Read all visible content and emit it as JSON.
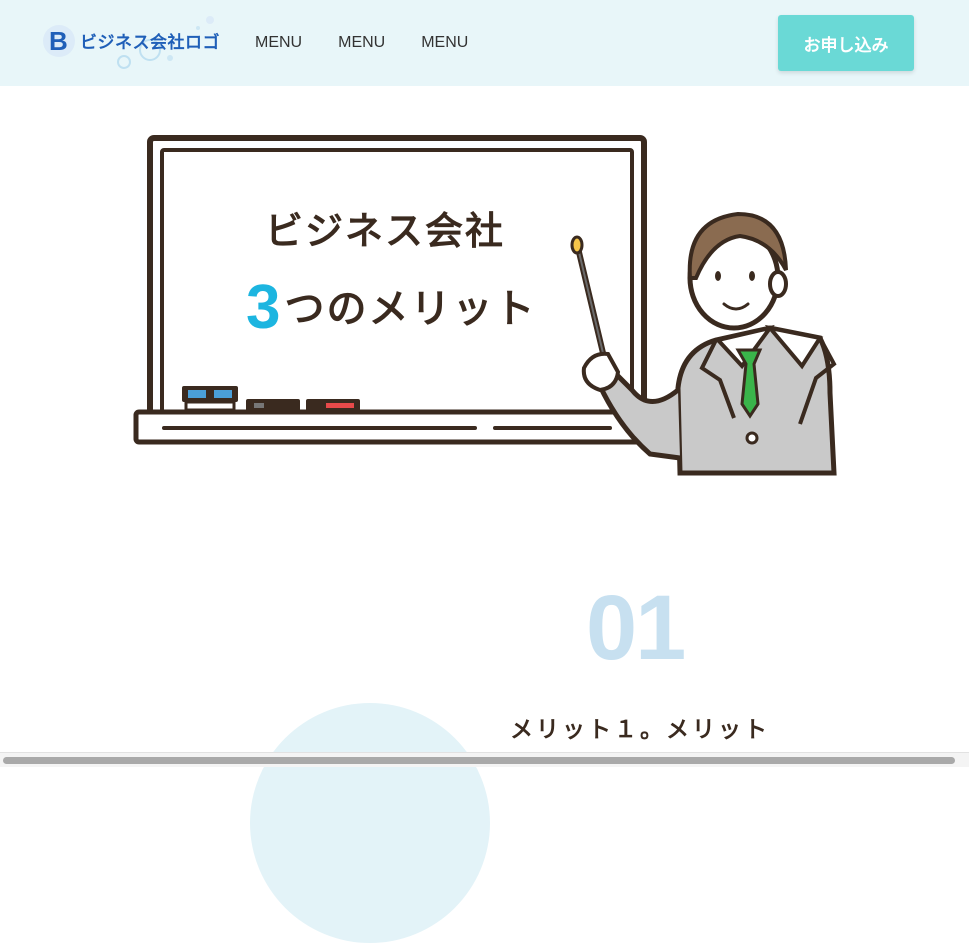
{
  "header": {
    "logo_text": "ビジネス会社ロゴ",
    "logo_letter": "B",
    "nav": [
      "MENU",
      "MENU",
      "MENU"
    ],
    "cta_label": "お申し込み"
  },
  "hero": {
    "title": "ビジネス会社",
    "sub_number": "3",
    "sub_text": "つのメリット"
  },
  "merit": {
    "number": "01",
    "title": "メリット１。メリット"
  },
  "colors": {
    "header_bg": "#e8f6f9",
    "cta": "#6ad9d6",
    "accent": "#1cb5e0",
    "merit_number": "#c7e0f0",
    "text": "#3a2a1f"
  }
}
